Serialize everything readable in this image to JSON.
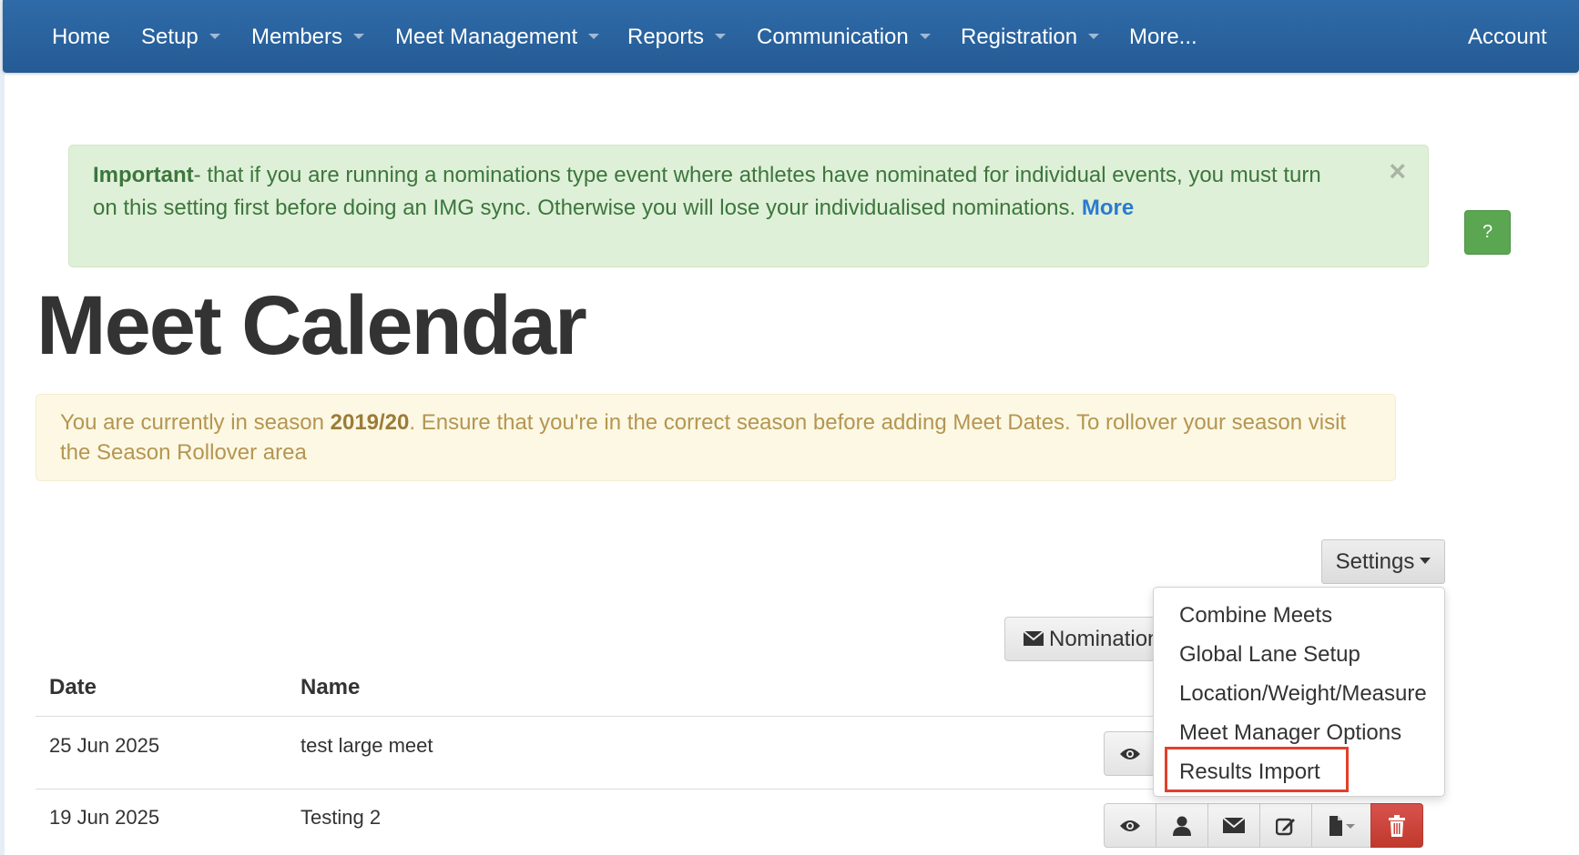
{
  "nav": {
    "items": [
      {
        "label": "Home",
        "dropdown": false
      },
      {
        "label": "Setup",
        "dropdown": true
      },
      {
        "label": "Members",
        "dropdown": true
      },
      {
        "label": "Meet Management",
        "dropdown": true
      },
      {
        "label": "Reports",
        "dropdown": true
      },
      {
        "label": "Communication",
        "dropdown": true
      },
      {
        "label": "Registration",
        "dropdown": true
      },
      {
        "label": "More...",
        "dropdown": false
      }
    ],
    "account": "Account"
  },
  "important_alert": {
    "lead": "Important",
    "text": "- that if you are running a nominations type event where athletes have nominated for individual events, you must turn on this setting first before doing an IMG sync. Otherwise you will lose your individualised nominations.",
    "more": "More",
    "close": "×"
  },
  "help_button": "?",
  "page_title": "Meet Calendar",
  "season_alert": {
    "before": "You are currently in season ",
    "season": "2019/20",
    "after": ". Ensure that you're in the correct season before adding Meet Dates. To rollover your season visit the Season Rollover area"
  },
  "settings": {
    "label": "Settings",
    "menu": [
      "Combine Meets",
      "Global Lane Setup",
      "Location/Weight/Measure",
      "Meet Manager Options",
      "Results Import"
    ],
    "highlighted": "Results Import"
  },
  "nomination_button": "Nominations",
  "table": {
    "headers": [
      "Date",
      "Name"
    ],
    "rows": [
      {
        "date": "25 Jun 2025",
        "name": "test large meet"
      },
      {
        "date": "19 Jun 2025",
        "name": "Testing 2"
      }
    ]
  },
  "colors": {
    "navbar": "#2f6ba8",
    "success_alert": "#dff0d8",
    "warning_alert": "#fcf8e3",
    "danger": "#d9534f",
    "highlight": "#e2402b"
  }
}
